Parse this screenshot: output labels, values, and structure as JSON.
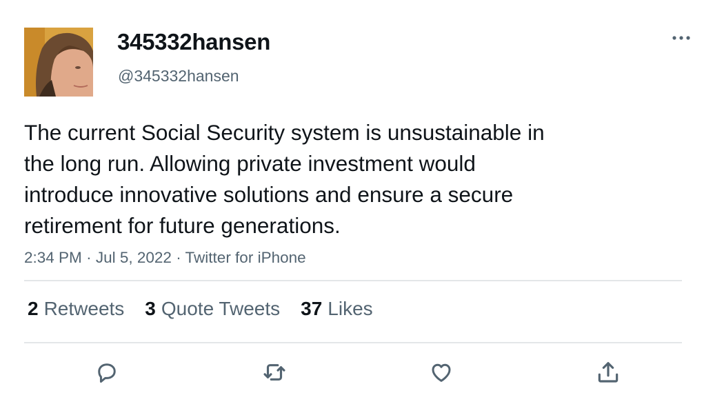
{
  "author": {
    "display_name": "345332hansen",
    "handle": "@345332hansen"
  },
  "tweet": {
    "text": "The current Social Security system is unsustainable in\nthe long run. Allowing private investment would\nintroduce innovative solutions and ensure a secure\nretirement for future generations.",
    "time": "2:34 PM",
    "separator": "·",
    "date": "Jul 5, 2022",
    "source": "Twitter for iPhone"
  },
  "stats": {
    "retweets_count": "2",
    "retweets_label": "Retweets",
    "quotes_count": "3",
    "quotes_label": "Quote Tweets",
    "likes_count": "37",
    "likes_label": "Likes"
  },
  "icons": {
    "more": "more-horizontal-icon",
    "reply": "reply-bubble-icon",
    "retweet": "retweet-arrows-icon",
    "like": "heart-icon",
    "share": "share-upload-icon"
  },
  "colors": {
    "text_primary": "#0f1419",
    "text_secondary": "#536471",
    "divider": "#e3e6e8"
  }
}
